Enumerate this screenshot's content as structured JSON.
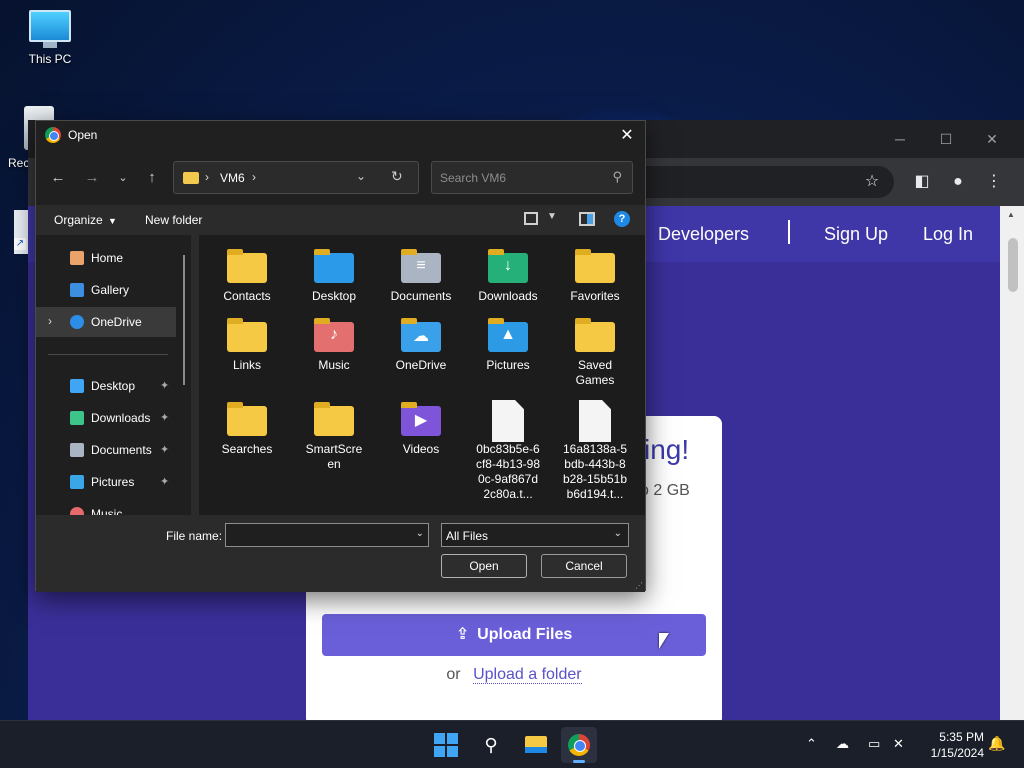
{
  "desktop": {
    "icons": [
      {
        "label": "This PC"
      },
      {
        "label": "Rec"
      }
    ]
  },
  "browser": {
    "nav": [
      "Developers",
      "|",
      "Sign Up",
      "Log In"
    ],
    "card": {
      "heading_fragment": "ing!",
      "subtext_fragment": "o 2 GB",
      "upload_button": "Upload Files",
      "or_text": "or",
      "upload_folder_link": "Upload a folder"
    }
  },
  "dialog": {
    "title": "Open",
    "address": {
      "segments": [
        "VM6"
      ]
    },
    "search": {
      "placeholder": "Search VM6"
    },
    "commands": {
      "organize": "Organize",
      "new_folder": "New folder"
    },
    "sidebar": [
      {
        "label": "Home",
        "icon": "home-icon",
        "color": "#e9a36b"
      },
      {
        "label": "Gallery",
        "icon": "gallery-icon",
        "color": "#3b8ee0"
      },
      {
        "label": "OneDrive",
        "icon": "onedrive-icon",
        "color": "#2d8ee8"
      },
      {
        "label": "Desktop",
        "icon": "desktop-icon",
        "color": "#3ea6f5"
      },
      {
        "label": "Downloads",
        "icon": "downloads-icon",
        "color": "#3cc48a"
      },
      {
        "label": "Documents",
        "icon": "documents-icon",
        "color": "#aab4c3"
      },
      {
        "label": "Pictures",
        "icon": "pictures-icon",
        "color": "#3aa6e8"
      },
      {
        "label": "Music",
        "icon": "music-icon",
        "color": "#e56b6b"
      }
    ],
    "files": [
      {
        "label": "Contacts",
        "kind": "folder"
      },
      {
        "label": "Desktop",
        "kind": "folder-desktop"
      },
      {
        "label": "Documents",
        "kind": "folder-documents"
      },
      {
        "label": "Downloads",
        "kind": "folder-downloads"
      },
      {
        "label": "Favorites",
        "kind": "folder"
      },
      {
        "label": "Links",
        "kind": "folder"
      },
      {
        "label": "Music",
        "kind": "folder-music"
      },
      {
        "label": "OneDrive",
        "kind": "folder-onedrive"
      },
      {
        "label": "Pictures",
        "kind": "folder-pictures"
      },
      {
        "label": "Saved Games",
        "kind": "folder"
      },
      {
        "label": "Searches",
        "kind": "folder"
      },
      {
        "label": "SmartScreen",
        "kind": "folder"
      },
      {
        "label": "Videos",
        "kind": "folder-videos"
      },
      {
        "label": "0bc83b5e-6cf8-4b13-980c-9af867d2c80a.t...",
        "kind": "document"
      },
      {
        "label": "16a8138a-5bdb-443b-8b28-15b51bb6d194.t...",
        "kind": "document"
      }
    ],
    "file_name": {
      "label": "File name:",
      "value": ""
    },
    "file_type": "All Files",
    "buttons": {
      "open": "Open",
      "cancel": "Cancel"
    }
  },
  "taskbar": {
    "time": "5:35 PM",
    "date": "1/15/2024"
  }
}
